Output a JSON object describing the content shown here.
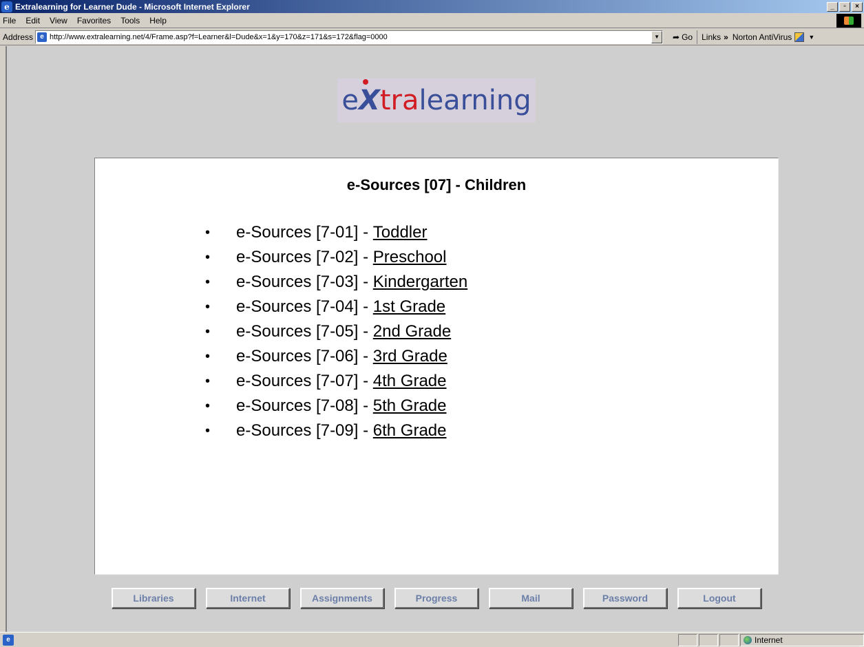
{
  "window": {
    "title": "Extralearning for Learner Dude - Microsoft Internet Explorer",
    "controls": [
      "_",
      "▫",
      "×"
    ]
  },
  "menu": {
    "items": [
      "File",
      "Edit",
      "View",
      "Favorites",
      "Tools",
      "Help"
    ]
  },
  "address_bar": {
    "label": "Address",
    "url": "http://www.extralearning.net/4/Frame.asp?f=Learner&l=Dude&x=1&y=170&z=171&s=172&flag=0000",
    "go_label": "Go",
    "links_label": "Links",
    "norton_label": "Norton AntiVirus"
  },
  "logo": {
    "e": "e",
    "x": "X",
    "tra": "tra",
    "learning": "learning"
  },
  "panel": {
    "title": "e-Sources [07] - Children",
    "items": [
      {
        "prefix": "e-Sources [7-01] - ",
        "link": "Toddler"
      },
      {
        "prefix": "e-Sources [7-02] - ",
        "link": "Preschool"
      },
      {
        "prefix": "e-Sources [7-03] - ",
        "link": "Kindergarten"
      },
      {
        "prefix": "e-Sources [7-04] - ",
        "link": "1st Grade"
      },
      {
        "prefix": "e-Sources [7-05] - ",
        "link": "2nd Grade"
      },
      {
        "prefix": "e-Sources [7-06] - ",
        "link": "3rd Grade"
      },
      {
        "prefix": "e-Sources [7-07] - ",
        "link": "4th Grade"
      },
      {
        "prefix": "e-Sources [7-08] - ",
        "link": "5th Grade"
      },
      {
        "prefix": "e-Sources [7-09] - ",
        "link": "6th Grade"
      }
    ]
  },
  "nav_buttons": [
    "Libraries",
    "Internet",
    "Assignments",
    "Progress",
    "Mail",
    "Password",
    "Logout"
  ],
  "status_bar": {
    "zone": "Internet"
  }
}
